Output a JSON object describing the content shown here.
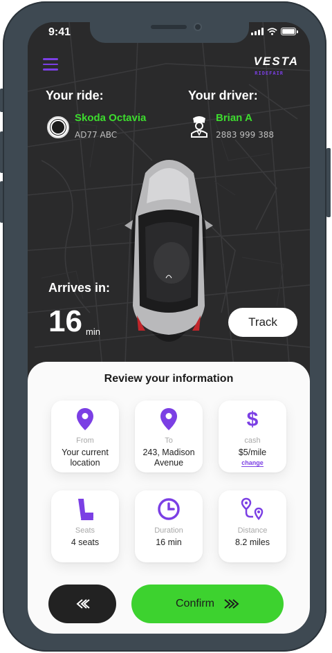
{
  "status_bar": {
    "time": "9:41"
  },
  "brand": {
    "name": "VESTA",
    "tagline": "RIDEFAIR"
  },
  "ride": {
    "label": "Your ride:",
    "car_name": "Skoda Octavia",
    "plate": "AD77 ABC"
  },
  "driver": {
    "label": "Your driver:",
    "name": "Brian A",
    "phone": "2883 999 388"
  },
  "eta": {
    "label": "Arrives in:",
    "value": "16",
    "unit": "min"
  },
  "track_label": "Track",
  "review": {
    "title": "Review your information",
    "cards": [
      {
        "icon": "map-pin-icon",
        "label": "From",
        "value": "Your current location"
      },
      {
        "icon": "map-pin-icon",
        "label": "To",
        "value": "243, Madison Avenue"
      },
      {
        "icon": "dollar-icon",
        "label": "cash",
        "value": "$5/mile",
        "action": "change"
      },
      {
        "icon": "car-seat-icon",
        "label": "Seats",
        "value": "4 seats"
      },
      {
        "icon": "clock-icon",
        "label": "Duration",
        "value": "16 min"
      },
      {
        "icon": "route-icon",
        "label": "Distance",
        "value": "8.2 miles"
      }
    ]
  },
  "actions": {
    "confirm_label": "Confirm"
  },
  "colors": {
    "accent": "#7b3fe4",
    "green": "#3dd22f",
    "dark": "#2a2a2b"
  }
}
